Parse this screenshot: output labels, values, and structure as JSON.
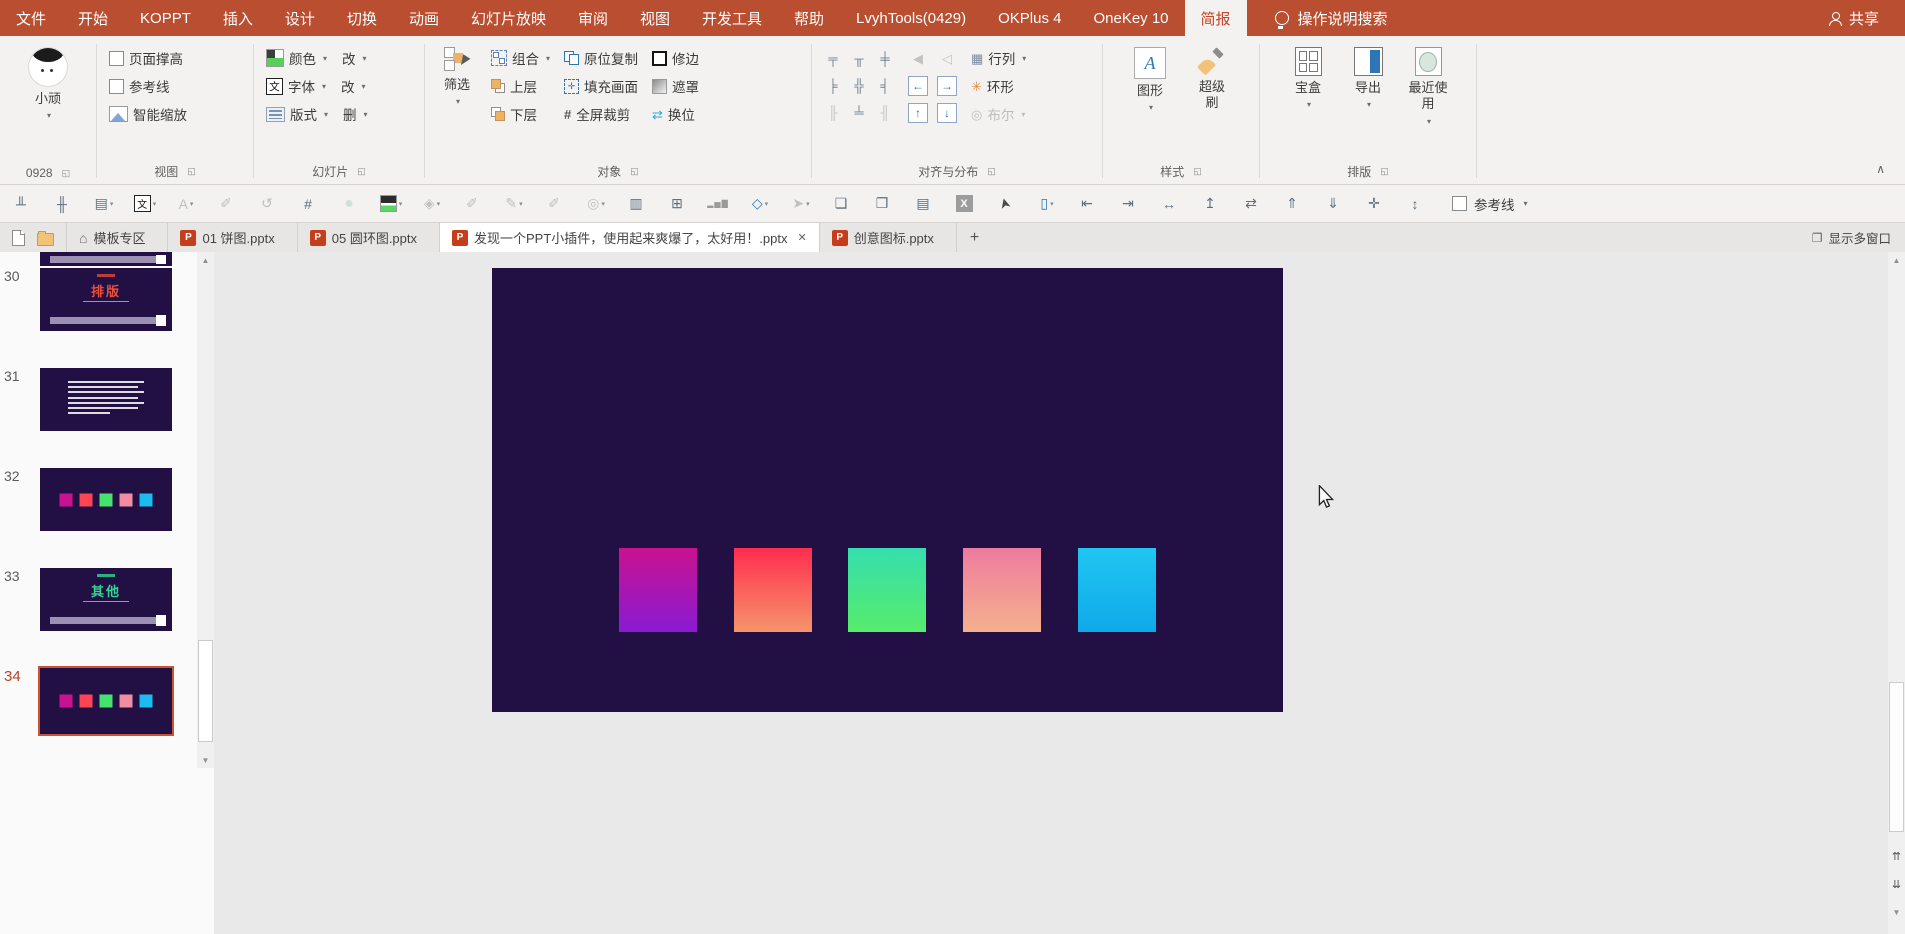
{
  "colors": {
    "titlebar": "#B94E31",
    "ribbon_bg": "#F3F2F1",
    "selection_accent": "#C75434",
    "slide_background": "#221045",
    "workspace_gray": "#E9E9E9"
  },
  "icons": {
    "caret": "▾",
    "launcher": "◱",
    "close": "✕",
    "collapse": "∧",
    "scroll_up": "▲",
    "scroll_down": "▼",
    "prev_slide": "⇈",
    "next_slide": "⇊",
    "new_tab": "+",
    "multi_window": "❐",
    "ppt_badge": "P",
    "home": "⌂",
    "shape_a": "A",
    "font_cn": "文",
    "fill_cross": "✛"
  },
  "menubar": {
    "tabs": [
      {
        "label": "文件",
        "cls": ""
      },
      {
        "label": "开始",
        "cls": ""
      },
      {
        "label": "KOPPT",
        "cls": ""
      },
      {
        "label": "插入",
        "cls": ""
      },
      {
        "label": "设计",
        "cls": ""
      },
      {
        "label": "切换",
        "cls": ""
      },
      {
        "label": "动画",
        "cls": ""
      },
      {
        "label": "幻灯片放映",
        "cls": ""
      },
      {
        "label": "审阅",
        "cls": ""
      },
      {
        "label": "视图",
        "cls": ""
      },
      {
        "label": "开发工具",
        "cls": ""
      },
      {
        "label": "帮助",
        "cls": ""
      },
      {
        "label": "LvyhTools(0429)",
        "cls": ""
      },
      {
        "label": "OKPlus 4",
        "cls": ""
      },
      {
        "label": "OneKey 10",
        "cls": ""
      },
      {
        "label": "简报",
        "cls": "active"
      }
    ],
    "search_label": "操作说明搜索",
    "share_label": "共享"
  },
  "ribbon": {
    "groups": [
      "0928",
      "视图",
      "幻灯片",
      "对象",
      "对齐与分布",
      "样式",
      "排版"
    ],
    "avatar_name": "小顽",
    "view_items": [
      "页面撑高",
      "参考线",
      "智能缩放"
    ],
    "slide_rows": [
      {
        "a": "颜色",
        "b": "改"
      },
      {
        "a": "字体",
        "b": "改"
      },
      {
        "a": "版式",
        "b": "删"
      }
    ],
    "object": {
      "filter_label": "筛选",
      "col2": [
        "组合",
        "上层",
        "下层"
      ],
      "col3": [
        "原位复制",
        "填充画面",
        "全屏裁剪"
      ],
      "col4": [
        "修边",
        "遮罩",
        "换位"
      ]
    },
    "align": {
      "grid": [
        {
          "n": "distribute-vertical-icon",
          "g": "╤",
          "cls": ""
        },
        {
          "n": "align-top-icon",
          "g": "╥",
          "cls": ""
        },
        {
          "n": "distribute-horizontal-icon",
          "g": "╪",
          "cls": ""
        },
        {
          "n": "align-left-icon",
          "g": "╞",
          "cls": ""
        },
        {
          "n": "center-both-icon",
          "g": "╬",
          "cls": ""
        },
        {
          "n": "align-right-icon",
          "g": "╡",
          "cls": ""
        },
        {
          "n": "stretch-horizontal-icon",
          "g": "╟",
          "cls": "dis"
        },
        {
          "n": "stretch-vertical-icon",
          "g": "╧",
          "cls": ""
        },
        {
          "n": "swap-size-icon",
          "g": "╢",
          "cls": "dis"
        }
      ],
      "nudges": [
        {
          "n": "flip-horizontal-icon",
          "g": "◀",
          "cls": "dis"
        },
        {
          "n": "flip-vertical-icon",
          "g": "◁",
          "cls": "dis"
        },
        {
          "n": "nudge-left-icon",
          "g": "←",
          "cls": "box"
        },
        {
          "n": "nudge-right-icon",
          "g": "→",
          "cls": "box"
        },
        {
          "n": "nudge-up-icon",
          "g": "↑",
          "cls": "box"
        },
        {
          "n": "nudge-down-icon",
          "g": "↓",
          "cls": "box"
        }
      ],
      "rows": [
        {
          "icon": "▦",
          "label": "行列",
          "caret": "▾",
          "cls": ""
        },
        {
          "icon": "✳",
          "label": "环形",
          "caret": "",
          "cls": ""
        },
        {
          "icon": "◎",
          "label": "布尔",
          "caret": "▾",
          "cls": "dis"
        }
      ]
    },
    "style_items": [
      "图形",
      "超级刷"
    ],
    "layout_items": [
      "宝盒",
      "导出",
      "最近使用"
    ]
  },
  "qat": {
    "icons": [
      {
        "n": "align-bottom-icon",
        "g": "╨",
        "cls": "",
        "c": ""
      },
      {
        "n": "distribute-gap-icon",
        "g": "╫",
        "cls": "",
        "c": ""
      },
      {
        "n": "paragraph-style-icon",
        "g": "▤",
        "cls": "",
        "c": "▾"
      },
      {
        "n": "font-box-icon",
        "g": "文",
        "cls": "boxed",
        "c": "▾"
      },
      {
        "n": "font-case-icon",
        "g": "A",
        "cls": "dis",
        "c": "▾"
      },
      {
        "n": "eyedropper-icon",
        "g": "✐",
        "cls": "dis",
        "c": ""
      },
      {
        "n": "image-reset-icon",
        "g": "↺",
        "cls": "dis",
        "c": ""
      },
      {
        "n": "crop-icon",
        "g": "#",
        "cls": "",
        "c": ""
      },
      {
        "n": "oval-shape-icon",
        "g": "●",
        "cls": "pale",
        "c": ""
      },
      {
        "n": "fill-color-icon",
        "g": " ",
        "cls": "swatch",
        "c": "▾"
      },
      {
        "n": "paint-bucket-icon",
        "g": "◈",
        "cls": "dis",
        "c": "▾"
      },
      {
        "n": "eyedropper-icon",
        "g": "✐",
        "cls": "dis",
        "c": ""
      },
      {
        "n": "pen-edit-icon",
        "g": "✎",
        "cls": "dis",
        "c": "▾"
      },
      {
        "n": "eyedropper-icon",
        "g": "✐",
        "cls": "dis",
        "c": ""
      },
      {
        "n": "boolean-ops-icon",
        "g": "◎",
        "cls": "dis",
        "c": "▾"
      },
      {
        "n": "columns-icon",
        "g": "▥",
        "cls": "",
        "c": ""
      },
      {
        "n": "table-edit-icon",
        "g": "⊞",
        "cls": "",
        "c": ""
      },
      {
        "n": "mini-chart-icon",
        "g": "▂▅▇",
        "cls": "tiny",
        "c": ""
      },
      {
        "n": "shapes-icon",
        "g": "◇",
        "cls": "blue",
        "c": "▾"
      },
      {
        "n": "arrow-shape-icon",
        "g": "➤",
        "cls": "dis",
        "c": "▾"
      },
      {
        "n": "bring-front-icon",
        "g": "❏",
        "cls": "",
        "c": ""
      },
      {
        "n": "send-back-icon",
        "g": "❐",
        "cls": "",
        "c": ""
      },
      {
        "n": "textbox-icon",
        "g": "▤",
        "cls": "blue",
        "c": ""
      },
      {
        "n": "no-fill-icon",
        "g": "X",
        "cls": "xbox",
        "c": ""
      },
      {
        "n": "select-object-icon",
        "g": "➤",
        "cls": "sel",
        "c": ""
      },
      {
        "n": "selection-frame-icon",
        "g": "▯",
        "cls": "blue",
        "c": "▾"
      },
      {
        "n": "align-left-edge-icon",
        "g": "⇤",
        "cls": "",
        "c": ""
      },
      {
        "n": "align-right-edge-icon",
        "g": "⇥",
        "cls": "",
        "c": ""
      },
      {
        "n": "distribute-center-icon",
        "g": "↔",
        "cls": "",
        "c": ""
      },
      {
        "n": "align-top-edge-icon",
        "g": "↥",
        "cls": "",
        "c": ""
      },
      {
        "n": "swap-picture-icon",
        "g": "⇄",
        "cls": "",
        "c": ""
      },
      {
        "n": "move-up-icon",
        "g": "⇑",
        "cls": "",
        "c": ""
      },
      {
        "n": "move-down-icon",
        "g": "⇓",
        "cls": "",
        "c": ""
      },
      {
        "n": "format-fill-icon",
        "g": "✛",
        "cls": "",
        "c": ""
      },
      {
        "n": "resize-icon",
        "g": "↕",
        "cls": "",
        "c": ""
      }
    ],
    "guides_label": "参考线"
  },
  "filetabs": {
    "items": [
      {
        "badge": "⌂",
        "bcls": "ico-home",
        "label": "模板专区",
        "cls": "",
        "close": ""
      },
      {
        "badge": "P",
        "bcls": "ico-ppt",
        "label": "01 饼图.pptx",
        "cls": "",
        "close": ""
      },
      {
        "badge": "P",
        "bcls": "ico-ppt",
        "label": "05 圆环图.pptx",
        "cls": "",
        "close": ""
      },
      {
        "badge": "P",
        "bcls": "ico-ppt",
        "label": "发现一个PPT小插件，使用起来爽爆了，太好用！.pptx",
        "cls": "active",
        "close": "✕"
      },
      {
        "badge": "P",
        "bcls": "ico-ppt",
        "label": "创意图标.pptx",
        "cls": "",
        "close": ""
      }
    ],
    "new_tab_label": "+",
    "multi_window_label": "显示多窗口"
  },
  "slides_panel": {
    "items": [
      {
        "num": "30",
        "title": "排版"
      },
      {
        "num": "31"
      },
      {
        "num": "32"
      },
      {
        "num": "33",
        "title": "其他"
      },
      {
        "num": "34"
      }
    ],
    "swatches": [
      {
        "n": "mini-swatch-magenta",
        "fill": "#C9128F"
      },
      {
        "n": "mini-swatch-red",
        "fill": "#FF4553"
      },
      {
        "n": "mini-swatch-green",
        "fill": "#45E36E"
      },
      {
        "n": "mini-swatch-pink",
        "fill": "#F28CA0"
      },
      {
        "n": "mini-swatch-cyan",
        "fill": "#1BBCEF"
      }
    ]
  },
  "canvas": {
    "squares": [
      {
        "n": "gradient-square-magenta-purple",
        "from": "#C9128F",
        "to": "#8A1AD3"
      },
      {
        "n": "gradient-square-red-salmon",
        "from": "#FF2D4E",
        "to": "#F5946B"
      },
      {
        "n": "gradient-square-teal-green",
        "from": "#35DEAE",
        "to": "#57EC6C"
      },
      {
        "n": "gradient-square-pink-peach",
        "from": "#EE7B9E",
        "to": "#F5B08C"
      },
      {
        "n": "gradient-square-cyan",
        "from": "#20C6F2",
        "to": "#0FA9E9"
      }
    ]
  }
}
